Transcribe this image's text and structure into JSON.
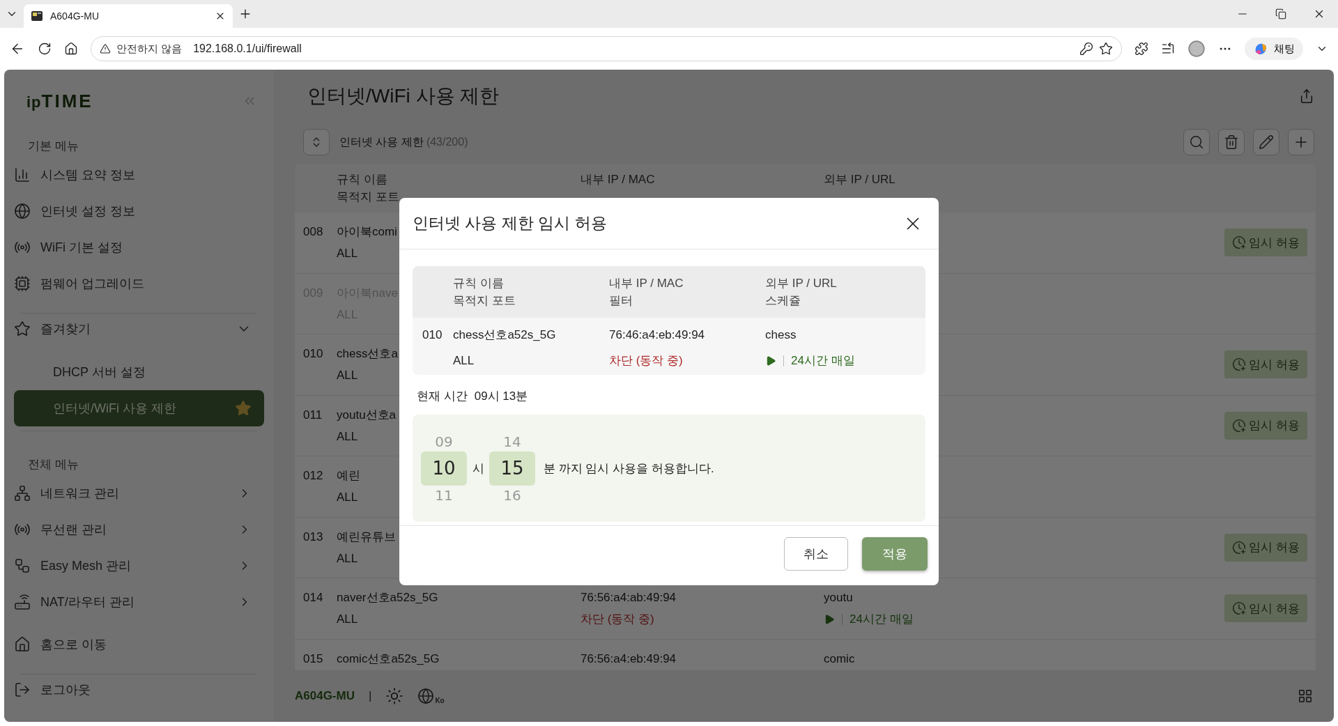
{
  "browser": {
    "tab": {
      "title": "A604G-MU"
    },
    "security": "안전하지 않음",
    "url": "192.168.0.1/ui/firewall",
    "chat": "채팅"
  },
  "sidebar": {
    "logo": {
      "prefix": "ip",
      "main": "TIME"
    },
    "basic": {
      "title": "기본 메뉴",
      "items": [
        "시스템 요약 정보",
        "인터넷 설정 정보",
        "WiFi 기본 설정",
        "펌웨어 업그레이드"
      ]
    },
    "favorites": {
      "label": "즐겨찾기",
      "expanded": true,
      "children": [
        {
          "label": "DHCP 서버 설정",
          "selected": false,
          "starred": false
        },
        {
          "label": "인터넷/WiFi 사용 제한",
          "selected": true,
          "starred": true
        }
      ]
    },
    "all": {
      "title": "전체 메뉴",
      "items": [
        {
          "label": "네트워크 관리",
          "expanded": false
        },
        {
          "label": "무선랜 관리",
          "expanded": false
        },
        {
          "label": "Easy Mesh 관리",
          "expanded": false
        },
        {
          "label": "NAT/라우터 관리",
          "expanded": false
        }
      ]
    },
    "bottom": [
      "홈으로 이동",
      "로그아웃"
    ]
  },
  "main": {
    "title": "인터넷/WiFi 사용 제한",
    "list_label": "인터넷 사용 제한",
    "count": "(43/200)",
    "columns": [
      [
        "규칙 이름",
        "목적지 포트"
      ],
      [
        "내부 IP / MAC"
      ],
      [
        "외부 IP / URL"
      ]
    ],
    "rows": [
      {
        "no": "008",
        "name": "아이북comi",
        "port": "ALL",
        "disabled": false,
        "button": "임시 허용"
      },
      {
        "no": "009",
        "name": "아이북nave",
        "port": "ALL",
        "disabled": true
      },
      {
        "no": "010",
        "name": "chess선호a",
        "port": "ALL",
        "disabled": false,
        "button": "임시 허용"
      },
      {
        "no": "011",
        "name": "youtu선호a",
        "port": "ALL",
        "disabled": false,
        "button": "임시 허용"
      },
      {
        "no": "012",
        "name": "예린",
        "port": "ALL",
        "disabled": false
      },
      {
        "no": "013",
        "name": "예린유튜브",
        "port": "ALL",
        "disabled": false,
        "button": "임시 허용"
      },
      {
        "no": "014",
        "name": "naver선호a52s_5G",
        "port": "ALL",
        "mac": "76:56:a4:ab:49:94",
        "filter": "차단 (동작 중)",
        "url": "youtu",
        "schedule": "24시간 매일",
        "disabled": false,
        "button": "임시 허용"
      },
      {
        "no": "015",
        "name": "comic선호a52s_5G",
        "mac": "76:56:a4:eb:49:94",
        "url": "comic",
        "disabled": false
      }
    ]
  },
  "footer": {
    "device": "A604G-MU",
    "separator": "|",
    "language": "Ko"
  },
  "modal": {
    "title": "인터넷 사용 제한 임시 허용",
    "columns": [
      [
        "규칙 이름",
        "목적지 포트"
      ],
      [
        "내부 IP / MAC",
        "필터"
      ],
      [
        "외부 IP / URL",
        "스케쥴"
      ]
    ],
    "row": {
      "no": "010",
      "name": "chess선호a52s_5G",
      "port": "ALL",
      "mac": "76:46:a4:eb:49:94",
      "filter": "차단 (동작 중)",
      "url": "chess",
      "schedule": "24시간 매일"
    },
    "current_time_label": "현재 시간",
    "current_time": "09시 13분",
    "hours": {
      "prev": "09",
      "value": "10",
      "next": "11"
    },
    "hour_unit": "시",
    "minutes": {
      "prev": "14",
      "value": "15",
      "next": "16"
    },
    "suffix": "분 까지 임시 사용을 허용합니다.",
    "buttons": [
      {
        "label": "취소",
        "kind": "secondary"
      },
      {
        "label": "적용",
        "kind": "primary"
      }
    ]
  }
}
